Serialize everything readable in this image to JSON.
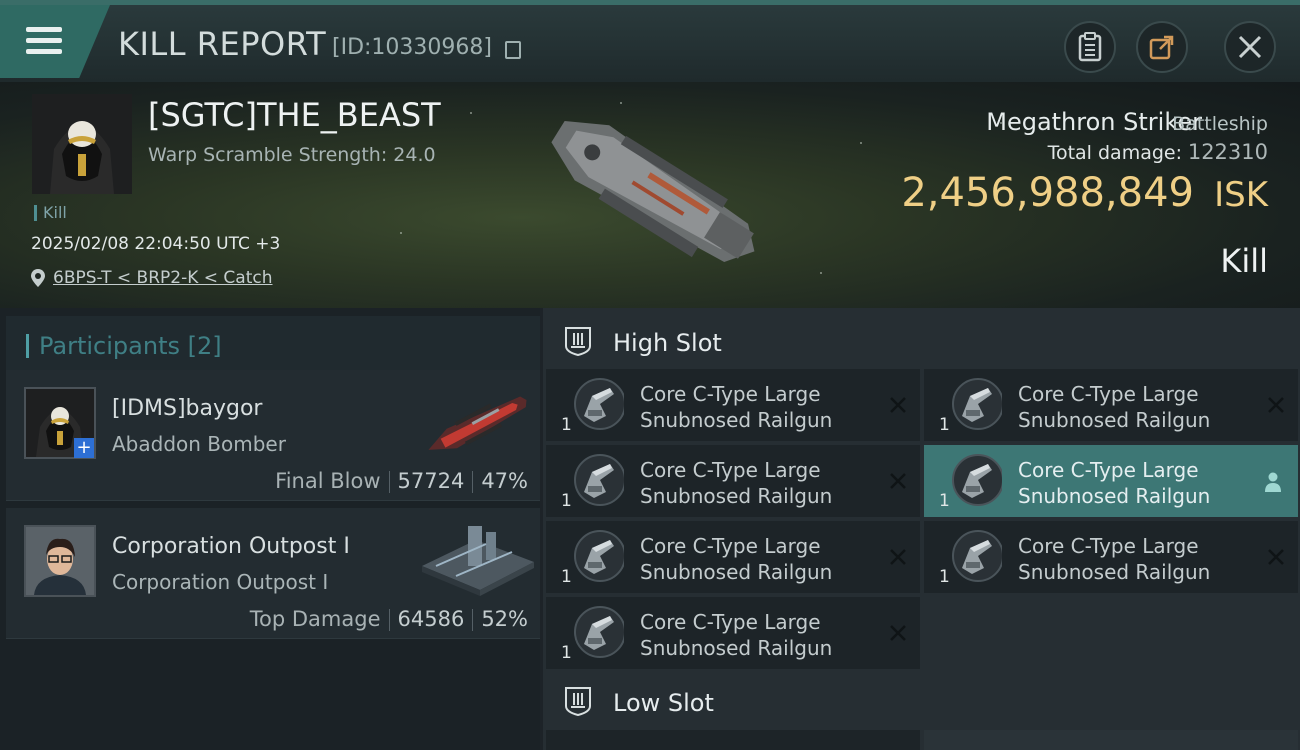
{
  "header": {
    "title": "KILL REPORT",
    "report_id": "[ID:10330968]",
    "icons": [
      "menu-icon",
      "copy-icon",
      "clipboard-icon",
      "share-icon",
      "close-icon"
    ]
  },
  "victim": {
    "name": "[SGTC]THE_BEAST",
    "warp_scramble": "Warp Scramble Strength: 24.0",
    "tag": "Kill",
    "timestamp": "2025/02/08 22:04:50 UTC +3",
    "location": "6BPS-T < BRP2-K < Catch",
    "ship_name": "Megathron Striker",
    "ship_class": "Battleship",
    "total_damage_label": "Total damage:",
    "total_damage_value": "122310",
    "isk_value": "2,456,988,849",
    "isk_unit": "ISK",
    "kill_type": "Kill"
  },
  "participants": {
    "title": "Participants",
    "count": "[2]",
    "items": [
      {
        "name": "[IDMS]baygor",
        "ship": "Abaddon Bomber",
        "role": "Final Blow",
        "damage": "57724",
        "percent": "47%"
      },
      {
        "name": "Corporation Outpost I",
        "ship": "Corporation Outpost I",
        "role": "Top Damage",
        "damage": "64586",
        "percent": "52%"
      }
    ]
  },
  "fitting": {
    "high_slot_title": "High Slot",
    "low_slot_title": "Low Slot",
    "modules": [
      {
        "line1": "Core C-Type Large",
        "line2": "Snubnosed Railgun",
        "qty": "1",
        "status": "destroyed"
      },
      {
        "line1": "Core C-Type Large",
        "line2": "Snubnosed Railgun",
        "qty": "1",
        "status": "destroyed"
      },
      {
        "line1": "Core C-Type Large",
        "line2": "Snubnosed Railgun",
        "qty": "1",
        "status": "destroyed"
      },
      {
        "line1": "Core C-Type Large",
        "line2": "Snubnosed Railgun",
        "qty": "1",
        "status": "dropped"
      },
      {
        "line1": "Core C-Type Large",
        "line2": "Snubnosed Railgun",
        "qty": "1",
        "status": "destroyed"
      },
      {
        "line1": "Core C-Type Large",
        "line2": "Snubnosed Railgun",
        "qty": "1",
        "status": "destroyed"
      },
      {
        "line1": "Core C-Type Large",
        "line2": "Snubnosed Railgun",
        "qty": "1",
        "status": "destroyed"
      }
    ]
  },
  "colors": {
    "accent": "#3d7775",
    "isk": "#efcf86",
    "menu": "#2f6a63"
  }
}
